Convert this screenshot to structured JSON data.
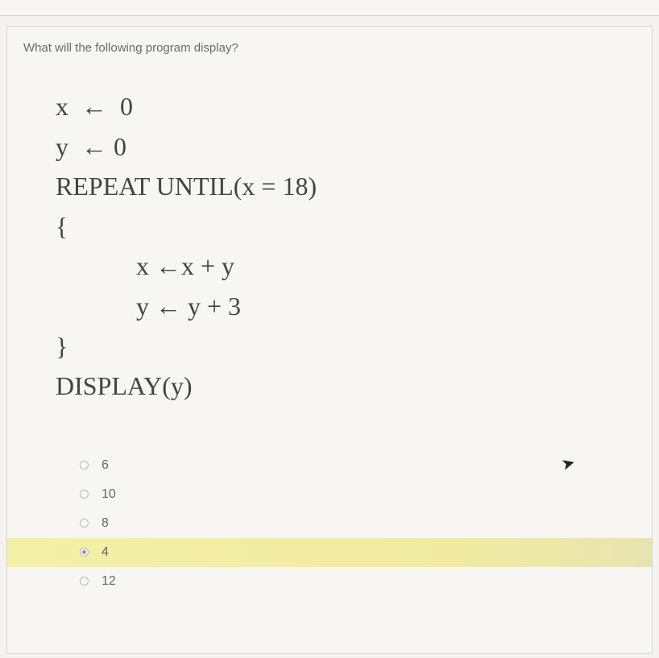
{
  "question": "What will the following program display?",
  "code": {
    "line1_var": "x",
    "line1_val": "0",
    "line2_var": "y",
    "line2_val": "0",
    "line3": "REPEAT UNTIL(x = 18)",
    "line4": "{",
    "line5_left": "x",
    "line5_right": "x + y",
    "line6_left": "y",
    "line6_right": " y + 3",
    "line7": "}",
    "line8": "DISPLAY(y)"
  },
  "answers": [
    {
      "label": "6",
      "selected": false,
      "highlighted": false
    },
    {
      "label": "10",
      "selected": false,
      "highlighted": false
    },
    {
      "label": "8",
      "selected": false,
      "highlighted": false
    },
    {
      "label": "4",
      "selected": true,
      "highlighted": true
    },
    {
      "label": "12",
      "selected": false,
      "highlighted": false
    }
  ]
}
